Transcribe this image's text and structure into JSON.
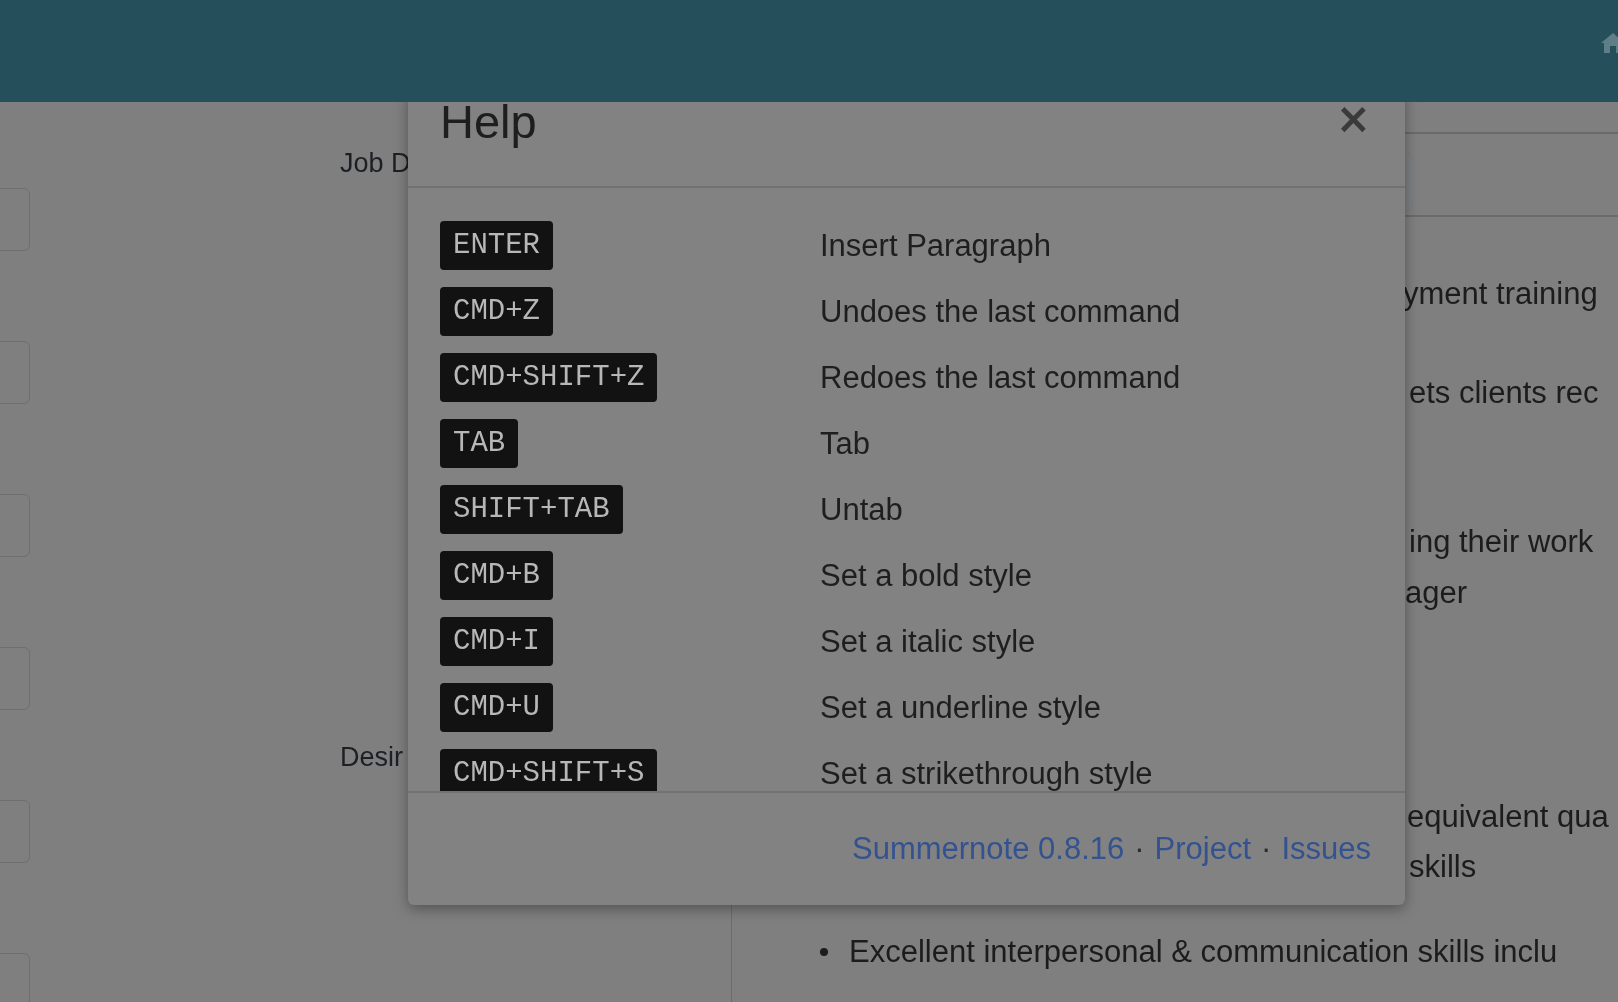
{
  "page": {
    "field_labels": [
      "Job D",
      "Desir"
    ],
    "side_text": [
      "yment training",
      "ets clients rec",
      "ing their work",
      "ager",
      "equivalent qua",
      "skills"
    ],
    "list_items": [
      "Excellent interpersonal & communication skills inclu"
    ]
  },
  "modal": {
    "title": "Help",
    "close": "×",
    "shortcuts": [
      {
        "key": "ENTER",
        "description": "Insert Paragraph"
      },
      {
        "key": "CMD+Z",
        "description": "Undoes the last command"
      },
      {
        "key": "CMD+SHIFT+Z",
        "description": "Redoes the last command"
      },
      {
        "key": "TAB",
        "description": "Tab"
      },
      {
        "key": "SHIFT+TAB",
        "description": "Untab"
      },
      {
        "key": "CMD+B",
        "description": "Set a bold style"
      },
      {
        "key": "CMD+I",
        "description": "Set a italic style"
      },
      {
        "key": "CMD+U",
        "description": "Set a underline style"
      },
      {
        "key": "CMD+SHIFT+S",
        "description": "Set a strikethrough style"
      }
    ],
    "footer": [
      {
        "kind": "link",
        "text": "Summernote 0.8.16"
      },
      {
        "kind": "separator",
        "text": "·"
      },
      {
        "kind": "link",
        "text": "Project"
      },
      {
        "kind": "separator",
        "text": "·"
      },
      {
        "kind": "link",
        "text": "Issues"
      }
    ]
  }
}
